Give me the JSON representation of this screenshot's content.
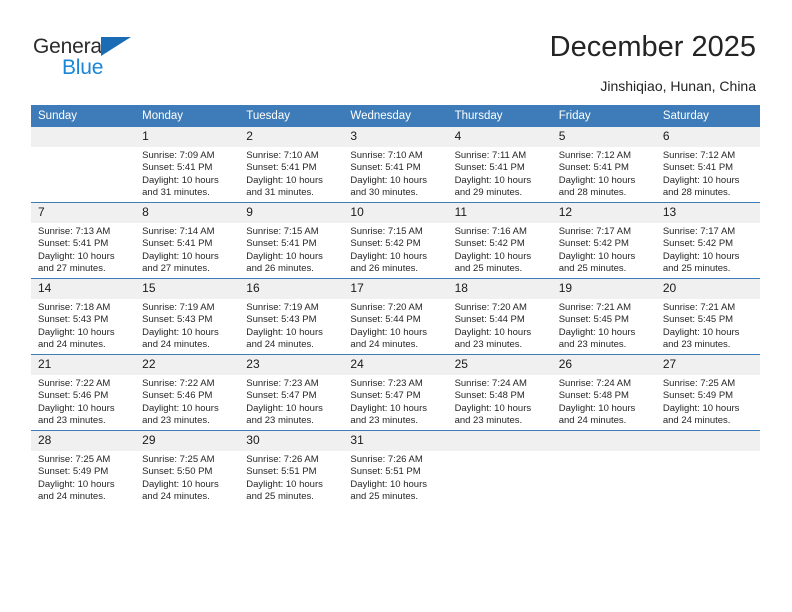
{
  "brand": {
    "name_part1": "General",
    "name_part2": "Blue",
    "triangle_color": "#1a6cb5",
    "blue_text_color": "#1a86d8"
  },
  "header": {
    "title": "December 2025",
    "subtitle": "Jinshiqiao, Hunan, China"
  },
  "theme": {
    "header_row_bg": "#3d7cb8",
    "daynum_bg": "#f0f0f0",
    "grid_line": "#3d7cb8",
    "text": "#262626"
  },
  "weekdays": [
    "Sunday",
    "Monday",
    "Tuesday",
    "Wednesday",
    "Thursday",
    "Friday",
    "Saturday"
  ],
  "labels": {
    "sunrise_prefix": "Sunrise:",
    "sunset_prefix": "Sunset:",
    "daylight_prefix": "Daylight:"
  },
  "weeks": [
    [
      {
        "day": "",
        "blank": true
      },
      {
        "day": "1",
        "sunrise": "Sunrise: 7:09 AM",
        "sunset": "Sunset: 5:41 PM",
        "daylight": "Daylight: 10 hours and 31 minutes."
      },
      {
        "day": "2",
        "sunrise": "Sunrise: 7:10 AM",
        "sunset": "Sunset: 5:41 PM",
        "daylight": "Daylight: 10 hours and 31 minutes."
      },
      {
        "day": "3",
        "sunrise": "Sunrise: 7:10 AM",
        "sunset": "Sunset: 5:41 PM",
        "daylight": "Daylight: 10 hours and 30 minutes."
      },
      {
        "day": "4",
        "sunrise": "Sunrise: 7:11 AM",
        "sunset": "Sunset: 5:41 PM",
        "daylight": "Daylight: 10 hours and 29 minutes."
      },
      {
        "day": "5",
        "sunrise": "Sunrise: 7:12 AM",
        "sunset": "Sunset: 5:41 PM",
        "daylight": "Daylight: 10 hours and 28 minutes."
      },
      {
        "day": "6",
        "sunrise": "Sunrise: 7:12 AM",
        "sunset": "Sunset: 5:41 PM",
        "daylight": "Daylight: 10 hours and 28 minutes."
      }
    ],
    [
      {
        "day": "7",
        "sunrise": "Sunrise: 7:13 AM",
        "sunset": "Sunset: 5:41 PM",
        "daylight": "Daylight: 10 hours and 27 minutes."
      },
      {
        "day": "8",
        "sunrise": "Sunrise: 7:14 AM",
        "sunset": "Sunset: 5:41 PM",
        "daylight": "Daylight: 10 hours and 27 minutes."
      },
      {
        "day": "9",
        "sunrise": "Sunrise: 7:15 AM",
        "sunset": "Sunset: 5:41 PM",
        "daylight": "Daylight: 10 hours and 26 minutes."
      },
      {
        "day": "10",
        "sunrise": "Sunrise: 7:15 AM",
        "sunset": "Sunset: 5:42 PM",
        "daylight": "Daylight: 10 hours and 26 minutes."
      },
      {
        "day": "11",
        "sunrise": "Sunrise: 7:16 AM",
        "sunset": "Sunset: 5:42 PM",
        "daylight": "Daylight: 10 hours and 25 minutes."
      },
      {
        "day": "12",
        "sunrise": "Sunrise: 7:17 AM",
        "sunset": "Sunset: 5:42 PM",
        "daylight": "Daylight: 10 hours and 25 minutes."
      },
      {
        "day": "13",
        "sunrise": "Sunrise: 7:17 AM",
        "sunset": "Sunset: 5:42 PM",
        "daylight": "Daylight: 10 hours and 25 minutes."
      }
    ],
    [
      {
        "day": "14",
        "sunrise": "Sunrise: 7:18 AM",
        "sunset": "Sunset: 5:43 PM",
        "daylight": "Daylight: 10 hours and 24 minutes."
      },
      {
        "day": "15",
        "sunrise": "Sunrise: 7:19 AM",
        "sunset": "Sunset: 5:43 PM",
        "daylight": "Daylight: 10 hours and 24 minutes."
      },
      {
        "day": "16",
        "sunrise": "Sunrise: 7:19 AM",
        "sunset": "Sunset: 5:43 PM",
        "daylight": "Daylight: 10 hours and 24 minutes."
      },
      {
        "day": "17",
        "sunrise": "Sunrise: 7:20 AM",
        "sunset": "Sunset: 5:44 PM",
        "daylight": "Daylight: 10 hours and 24 minutes."
      },
      {
        "day": "18",
        "sunrise": "Sunrise: 7:20 AM",
        "sunset": "Sunset: 5:44 PM",
        "daylight": "Daylight: 10 hours and 23 minutes."
      },
      {
        "day": "19",
        "sunrise": "Sunrise: 7:21 AM",
        "sunset": "Sunset: 5:45 PM",
        "daylight": "Daylight: 10 hours and 23 minutes."
      },
      {
        "day": "20",
        "sunrise": "Sunrise: 7:21 AM",
        "sunset": "Sunset: 5:45 PM",
        "daylight": "Daylight: 10 hours and 23 minutes."
      }
    ],
    [
      {
        "day": "21",
        "sunrise": "Sunrise: 7:22 AM",
        "sunset": "Sunset: 5:46 PM",
        "daylight": "Daylight: 10 hours and 23 minutes."
      },
      {
        "day": "22",
        "sunrise": "Sunrise: 7:22 AM",
        "sunset": "Sunset: 5:46 PM",
        "daylight": "Daylight: 10 hours and 23 minutes."
      },
      {
        "day": "23",
        "sunrise": "Sunrise: 7:23 AM",
        "sunset": "Sunset: 5:47 PM",
        "daylight": "Daylight: 10 hours and 23 minutes."
      },
      {
        "day": "24",
        "sunrise": "Sunrise: 7:23 AM",
        "sunset": "Sunset: 5:47 PM",
        "daylight": "Daylight: 10 hours and 23 minutes."
      },
      {
        "day": "25",
        "sunrise": "Sunrise: 7:24 AM",
        "sunset": "Sunset: 5:48 PM",
        "daylight": "Daylight: 10 hours and 23 minutes."
      },
      {
        "day": "26",
        "sunrise": "Sunrise: 7:24 AM",
        "sunset": "Sunset: 5:48 PM",
        "daylight": "Daylight: 10 hours and 24 minutes."
      },
      {
        "day": "27",
        "sunrise": "Sunrise: 7:25 AM",
        "sunset": "Sunset: 5:49 PM",
        "daylight": "Daylight: 10 hours and 24 minutes."
      }
    ],
    [
      {
        "day": "28",
        "sunrise": "Sunrise: 7:25 AM",
        "sunset": "Sunset: 5:49 PM",
        "daylight": "Daylight: 10 hours and 24 minutes."
      },
      {
        "day": "29",
        "sunrise": "Sunrise: 7:25 AM",
        "sunset": "Sunset: 5:50 PM",
        "daylight": "Daylight: 10 hours and 24 minutes."
      },
      {
        "day": "30",
        "sunrise": "Sunrise: 7:26 AM",
        "sunset": "Sunset: 5:51 PM",
        "daylight": "Daylight: 10 hours and 25 minutes."
      },
      {
        "day": "31",
        "sunrise": "Sunrise: 7:26 AM",
        "sunset": "Sunset: 5:51 PM",
        "daylight": "Daylight: 10 hours and 25 minutes."
      },
      {
        "day": "",
        "blank": true
      },
      {
        "day": "",
        "blank": true
      },
      {
        "day": "",
        "blank": true
      }
    ]
  ]
}
